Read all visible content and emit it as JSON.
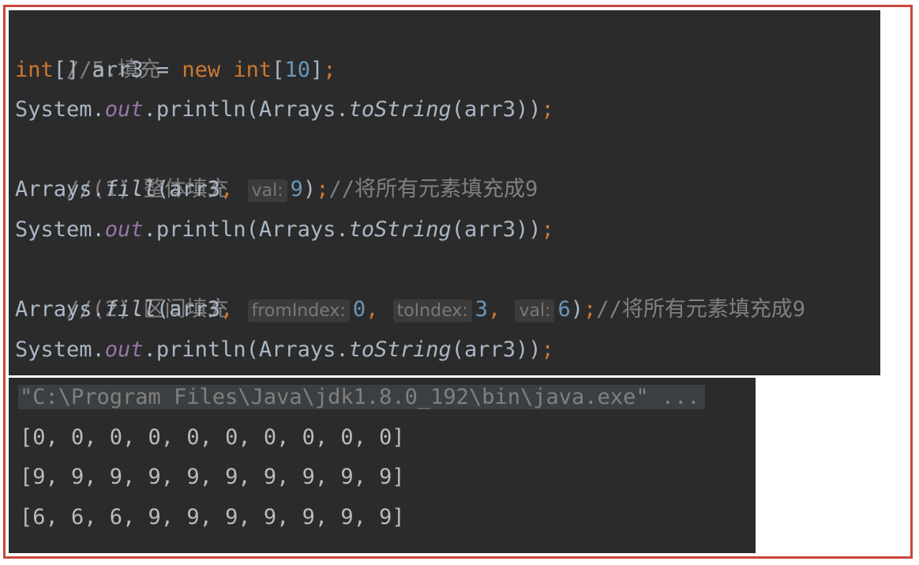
{
  "editor": {
    "lines": [
      {
        "comment": "//5.填充"
      },
      {
        "type": "int",
        "brackets": "[] ",
        "var": "arr3",
        "eq": " = ",
        "new": "new",
        "type2": "int",
        "open": "[",
        "size": "10",
        "close": "]",
        "semi": ";"
      },
      {
        "system": "System.",
        "out": "out",
        "println": ".println(Arrays.",
        "tostring": "toString",
        "arg": "(arr3))",
        "semi": ";"
      },
      {
        "comment": "//(1).整体填充"
      },
      {
        "prefix": "Arrays.",
        "method": "fill",
        "open": "(arr3",
        "comma": ", ",
        "hint_val": "val:",
        "val": "9",
        "close": ")",
        "semi": ";",
        "comment": "//将所有元素填充成9"
      },
      {
        "system": "System.",
        "out": "out",
        "println": ".println(Arrays.",
        "tostring": "toString",
        "arg": "(arr3))",
        "semi": ";"
      },
      {
        "comment": "//(2).区间填充"
      },
      {
        "prefix": "Arrays.",
        "method": "fill",
        "open": "(arr3",
        "comma1": ", ",
        "hint_from": "fromIndex:",
        "from": "0",
        "comma2": ", ",
        "hint_to": "toIndex:",
        "to": "3",
        "comma3": ", ",
        "hint_val": "val:",
        "val": "6",
        "close": ")",
        "semi": ";",
        "comment": "//将所有元素填充成9"
      },
      {
        "system": "System.",
        "out": "out",
        "println": ".println(Arrays.",
        "tostring": "toString",
        "arg": "(arr3))",
        "semi": ";"
      }
    ]
  },
  "console": {
    "command": "\"C:\\Program Files\\Java\\jdk1.8.0_192\\bin\\java.exe\" ...",
    "outputs": [
      "[0, 0, 0, 0, 0, 0, 0, 0, 0, 0]",
      "[9, 9, 9, 9, 9, 9, 9, 9, 9, 9]",
      "[6, 6, 6, 9, 9, 9, 9, 9, 9, 9]"
    ]
  },
  "colors": {
    "frame_border": "#c9463d",
    "editor_bg": "#2b2b2b",
    "keyword": "#cc7832",
    "number": "#6897bb",
    "comment": "#808080",
    "field": "#9876aa",
    "text": "#a9b7c6"
  }
}
